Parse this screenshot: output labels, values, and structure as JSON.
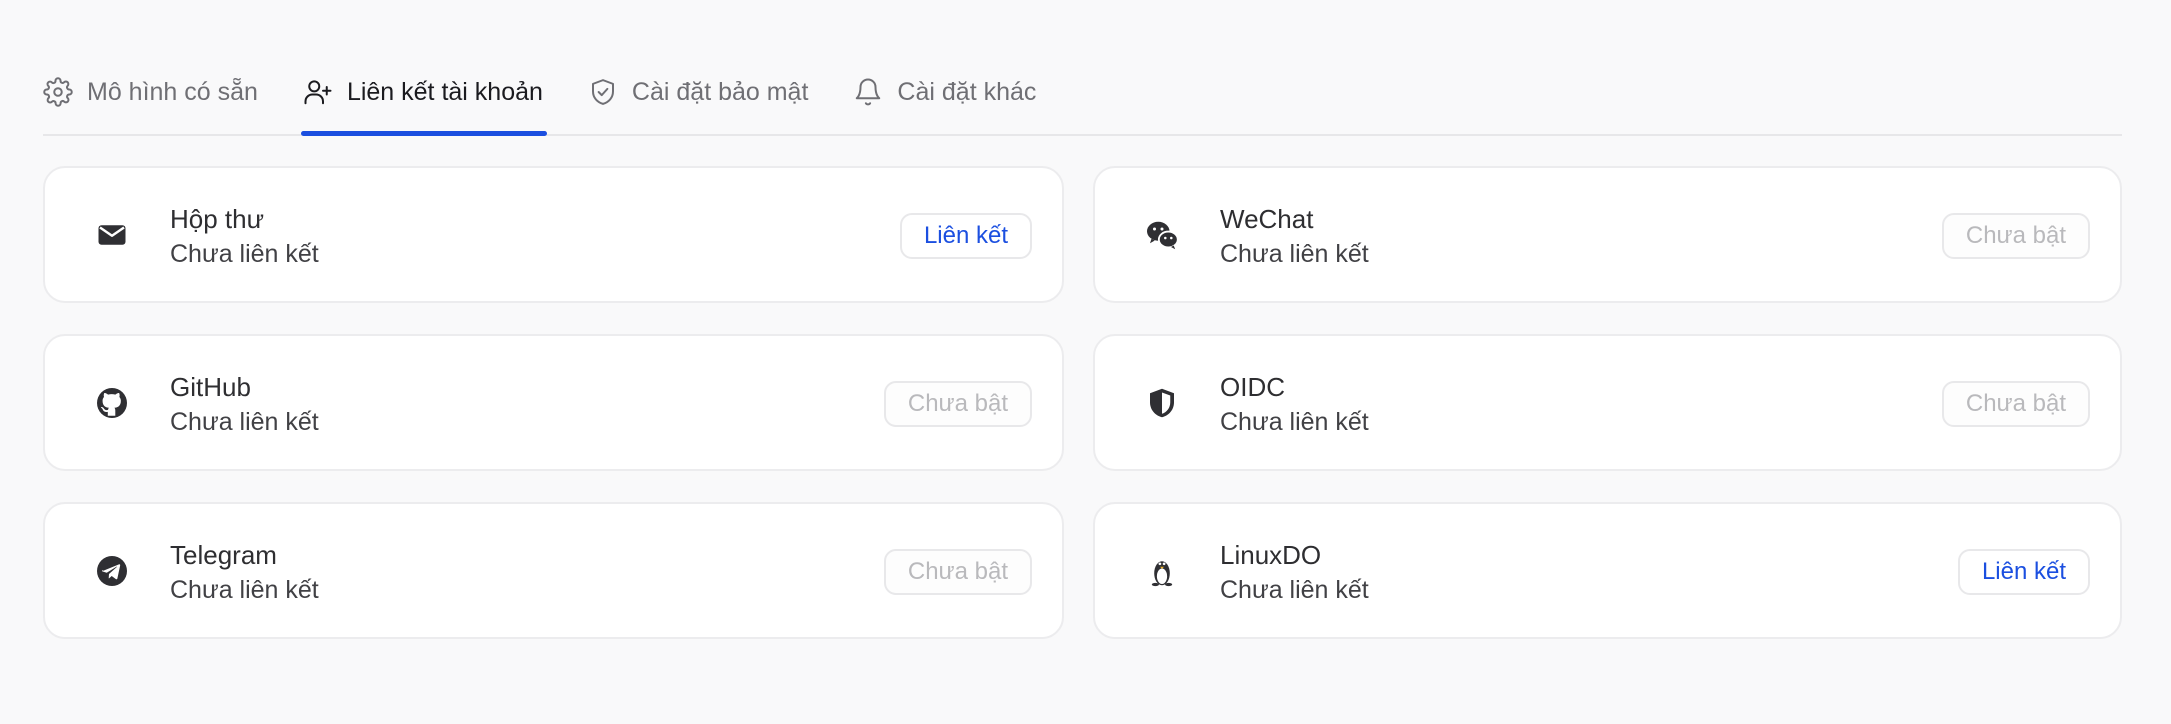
{
  "tabs": [
    {
      "label": "Mô hình có sẵn",
      "icon": "gear-icon",
      "active": false
    },
    {
      "label": "Liên kết tài khoản",
      "icon": "user-plus-icon",
      "active": true
    },
    {
      "label": "Cài đặt bảo mật",
      "icon": "shield-check-icon",
      "active": false
    },
    {
      "label": "Cài đặt khác",
      "icon": "bell-icon",
      "active": false
    }
  ],
  "accounts": [
    {
      "name": "Hộp thư",
      "status": "Chưa liên kết",
      "button": "Liên kết",
      "enabled": true,
      "icon": "mail-icon"
    },
    {
      "name": "WeChat",
      "status": "Chưa liên kết",
      "button": "Chưa bật",
      "enabled": false,
      "icon": "wechat-icon"
    },
    {
      "name": "GitHub",
      "status": "Chưa liên kết",
      "button": "Chưa bật",
      "enabled": false,
      "icon": "github-icon"
    },
    {
      "name": "OIDC",
      "status": "Chưa liên kết",
      "button": "Chưa bật",
      "enabled": false,
      "icon": "shield-icon"
    },
    {
      "name": "Telegram",
      "status": "Chưa liên kết",
      "button": "Chưa bật",
      "enabled": false,
      "icon": "telegram-icon"
    },
    {
      "name": "LinuxDO",
      "status": "Chưa liên kết",
      "button": "Liên kết",
      "enabled": true,
      "icon": "linux-penguin-icon"
    }
  ],
  "colors": {
    "accent": "#1b4fe0",
    "disabled_text": "#b9b9bc",
    "border": "#ececee"
  }
}
